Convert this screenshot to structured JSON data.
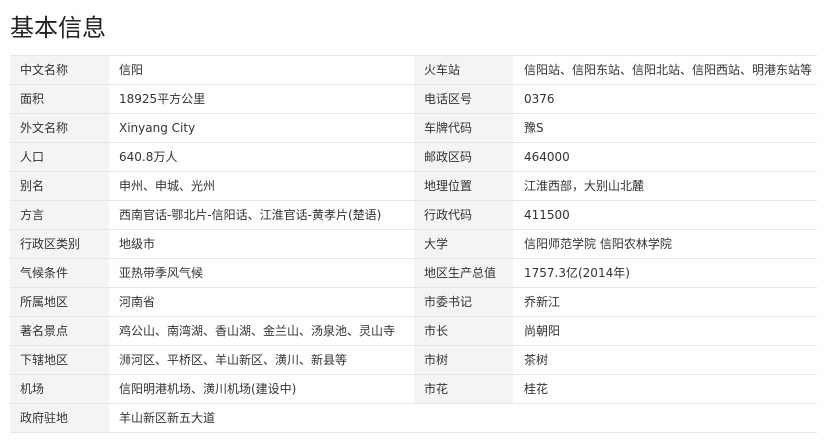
{
  "section_title": "基本信息",
  "rows": [
    {
      "k1": "中文名称",
      "v1": "信阳",
      "k2": "火车站",
      "v2": "信阳站、信阳东站、信阳北站、信阳西站、明港东站等"
    },
    {
      "k1": "面积",
      "v1": "18925平方公里",
      "k2": "电话区号",
      "v2": "0376"
    },
    {
      "k1": "外文名称",
      "v1": "Xinyang City",
      "k2": "车牌代码",
      "v2": "豫S"
    },
    {
      "k1": "人口",
      "v1": "640.8万人",
      "k2": "邮政区码",
      "v2": "464000"
    },
    {
      "k1": "别名",
      "v1": "申州、申城、光州",
      "k2": "地理位置",
      "v2": "江淮西部，大别山北麓"
    },
    {
      "k1": "方言",
      "v1": "西南官话-鄂北片-信阳话、江淮官话-黄孝片(楚语)",
      "k2": "行政代码",
      "v2": "411500"
    },
    {
      "k1": "行政区类别",
      "v1": "地级市",
      "k2": "大学",
      "v2": "信阳师范学院 信阳农林学院"
    },
    {
      "k1": "气候条件",
      "v1": "亚热带季风气候",
      "k2": "地区生产总值",
      "v2": "1757.3亿(2014年)"
    },
    {
      "k1": "所属地区",
      "v1": "河南省",
      "k2": "市委书记",
      "v2": "乔新江"
    },
    {
      "k1": "著名景点",
      "v1": "鸡公山、南湾湖、香山湖、金兰山、汤泉池、灵山寺",
      "k2": "市长",
      "v2": "尚朝阳"
    },
    {
      "k1": "下辖地区",
      "v1": "浉河区、平桥区、羊山新区、潢川、新县等",
      "k2": "市树",
      "v2": "茶树"
    },
    {
      "k1": "机场",
      "v1": "信阳明港机场、潢川机场(建设中)",
      "k2": "市花",
      "v2": "桂花"
    },
    {
      "k1": "政府驻地",
      "v1": "羊山新区新五大道"
    }
  ]
}
